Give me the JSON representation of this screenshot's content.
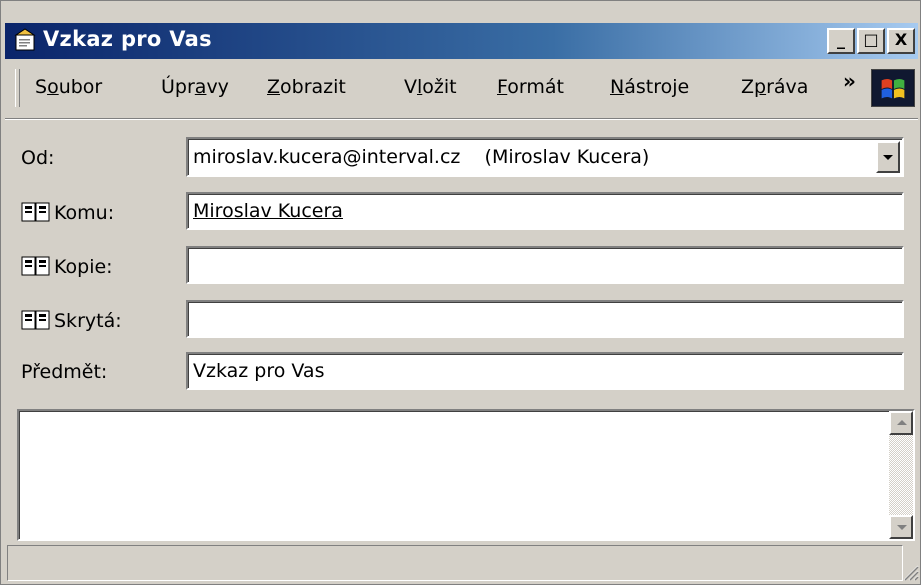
{
  "window": {
    "title": "Vzkaz pro Vas",
    "controls": [
      "_",
      "□",
      "X"
    ]
  },
  "menu": {
    "items": [
      {
        "pre": "S",
        "acc": "o",
        "post": "ubor"
      },
      {
        "pre": "Úpr",
        "acc": "a",
        "post": "vy"
      },
      {
        "pre": "",
        "acc": "Z",
        "post": "obrazit"
      },
      {
        "pre": "V",
        "acc": "l",
        "post": "ožit"
      },
      {
        "pre": "",
        "acc": "F",
        "post": "ormát"
      },
      {
        "pre": "",
        "acc": "N",
        "post": "ástroje"
      },
      {
        "pre": "Z",
        "acc": "p",
        "post": "ráva"
      }
    ],
    "more": "»"
  },
  "header": {
    "from_label": "Od:",
    "from_value": "miroslav.kucera@interval.cz    (Miroslav Kucera)",
    "to_label": "Komu:",
    "to_value": "Miroslav Kucera",
    "cc_label": "Kopie:",
    "cc_value": "",
    "bcc_label": "Skrytá:",
    "bcc_value": "",
    "subject_label": "Předmět:",
    "subject_value": "Vzkaz pro Vas"
  },
  "body": {
    "text": ""
  },
  "icons": {
    "app": "message-icon",
    "address_book": "address-book-icon",
    "logo": "windows-logo-icon"
  },
  "colors": {
    "titlebar_start": "#0a246a",
    "titlebar_end": "#a6caf0",
    "face": "#d4d0c8"
  }
}
